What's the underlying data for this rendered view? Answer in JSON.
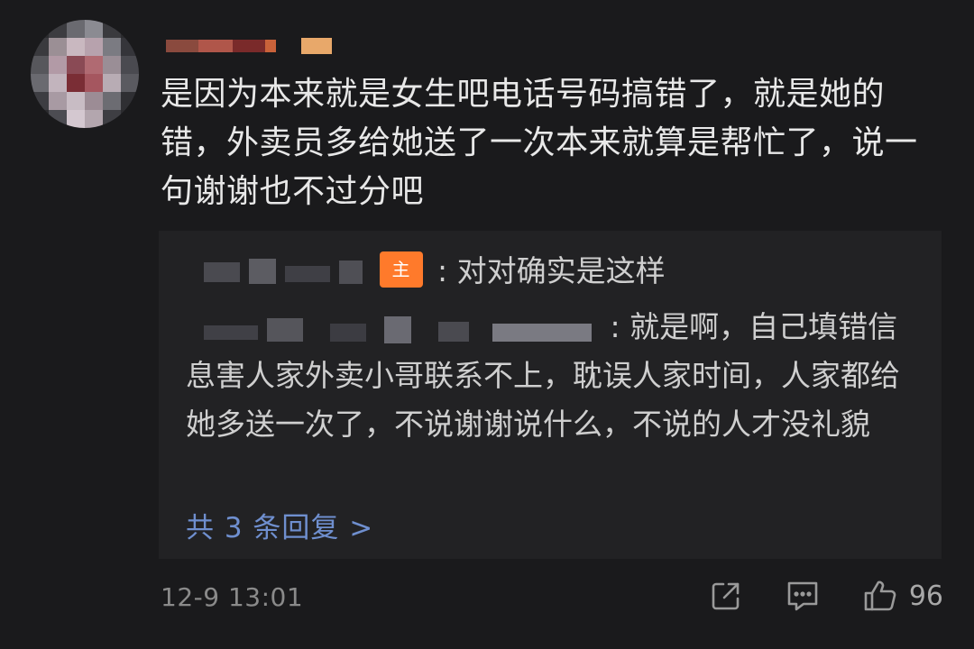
{
  "comment": {
    "avatar_icon": "blurred-avatar",
    "username_blurred": true,
    "text": "是因为本来就是女生吧电话号码搞错了，就是她的错，外卖员多给她送了一次本来就算是帮忙了，说一句谢谢也不过分吧"
  },
  "replies": [
    {
      "author_blurred": true,
      "badge": "主",
      "text": ": 对对确实是这样"
    },
    {
      "author_blurred": true,
      "text": ": 就是啊，自己填错信息害人家外卖小哥联系不上，耽误人家时间，人家都给她多送一次了，不说谢谢说什么，不说的人才没礼貌"
    }
  ],
  "more_replies_label": "共 3 条回复 >",
  "timestamp": "12-9 13:01",
  "actions": {
    "share_icon": "share-icon",
    "comment_icon": "comment-icon",
    "like_icon": "thumbs-up-icon",
    "like_count": "96"
  },
  "colors": {
    "background": "#1a1a1c",
    "reply_box": "#222224",
    "link": "#6f8fcf",
    "host_badge": "#ff7a2b"
  }
}
